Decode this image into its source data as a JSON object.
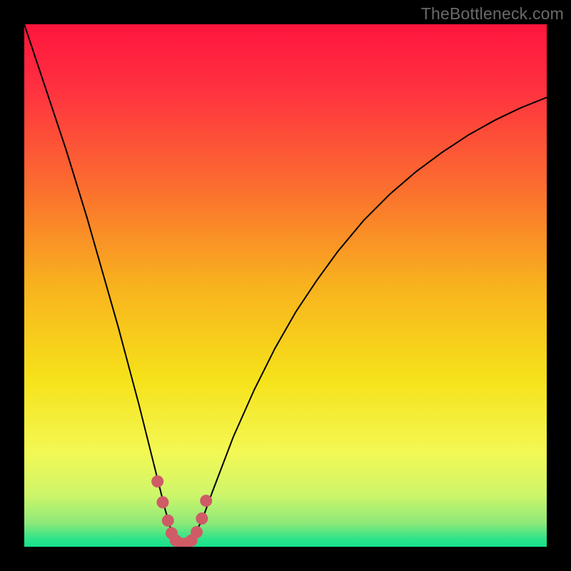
{
  "watermark": "TheBottleneck.com",
  "colors": {
    "frame": "#000000",
    "watermark": "#6a6a6a",
    "curve": "#000000",
    "dots_fill": "#cf5b67",
    "dots_stroke": "#cf5b67",
    "gradient_stops": [
      {
        "offset": 0.0,
        "color": "#ff153d"
      },
      {
        "offset": 0.12,
        "color": "#ff3040"
      },
      {
        "offset": 0.3,
        "color": "#fb6a30"
      },
      {
        "offset": 0.5,
        "color": "#f8b21e"
      },
      {
        "offset": 0.68,
        "color": "#f6e21a"
      },
      {
        "offset": 0.82,
        "color": "#f3f854"
      },
      {
        "offset": 0.9,
        "color": "#cef66a"
      },
      {
        "offset": 0.955,
        "color": "#8de978"
      },
      {
        "offset": 0.985,
        "color": "#2de38a"
      },
      {
        "offset": 1.0,
        "color": "#17e28c"
      }
    ]
  },
  "chart_data": {
    "type": "line",
    "title": "",
    "xlabel": "",
    "ylabel": "",
    "xlim": [
      0,
      100
    ],
    "ylim": [
      0,
      100
    ],
    "grid": false,
    "series": [
      {
        "name": "curve",
        "x": [
          0,
          2,
          4,
          6,
          8,
          10,
          12,
          14,
          16,
          18,
          20,
          22,
          24,
          26,
          27,
          28,
          29,
          30,
          31,
          32,
          34,
          36,
          40,
          44,
          48,
          52,
          56,
          60,
          65,
          70,
          75,
          80,
          85,
          90,
          95,
          100
        ],
        "values": [
          100,
          94,
          88,
          82,
          76,
          69.5,
          63,
          56,
          49,
          42,
          34.5,
          27,
          19,
          11,
          7,
          3.5,
          1.3,
          0.6,
          0.6,
          1.3,
          5,
          10.5,
          21,
          30,
          38,
          45,
          51,
          56.5,
          62.5,
          67.5,
          71.8,
          75.5,
          78.8,
          81.6,
          84,
          86
        ]
      },
      {
        "name": "highlight-dots",
        "x": [
          25.5,
          26.5,
          27.5,
          28.2,
          29.0,
          30.0,
          31.0,
          32.0,
          33.0,
          34.0,
          34.8
        ],
        "values": [
          12.5,
          8.5,
          5.0,
          2.6,
          1.2,
          0.6,
          0.6,
          1.2,
          2.8,
          5.4,
          8.8
        ]
      }
    ]
  }
}
